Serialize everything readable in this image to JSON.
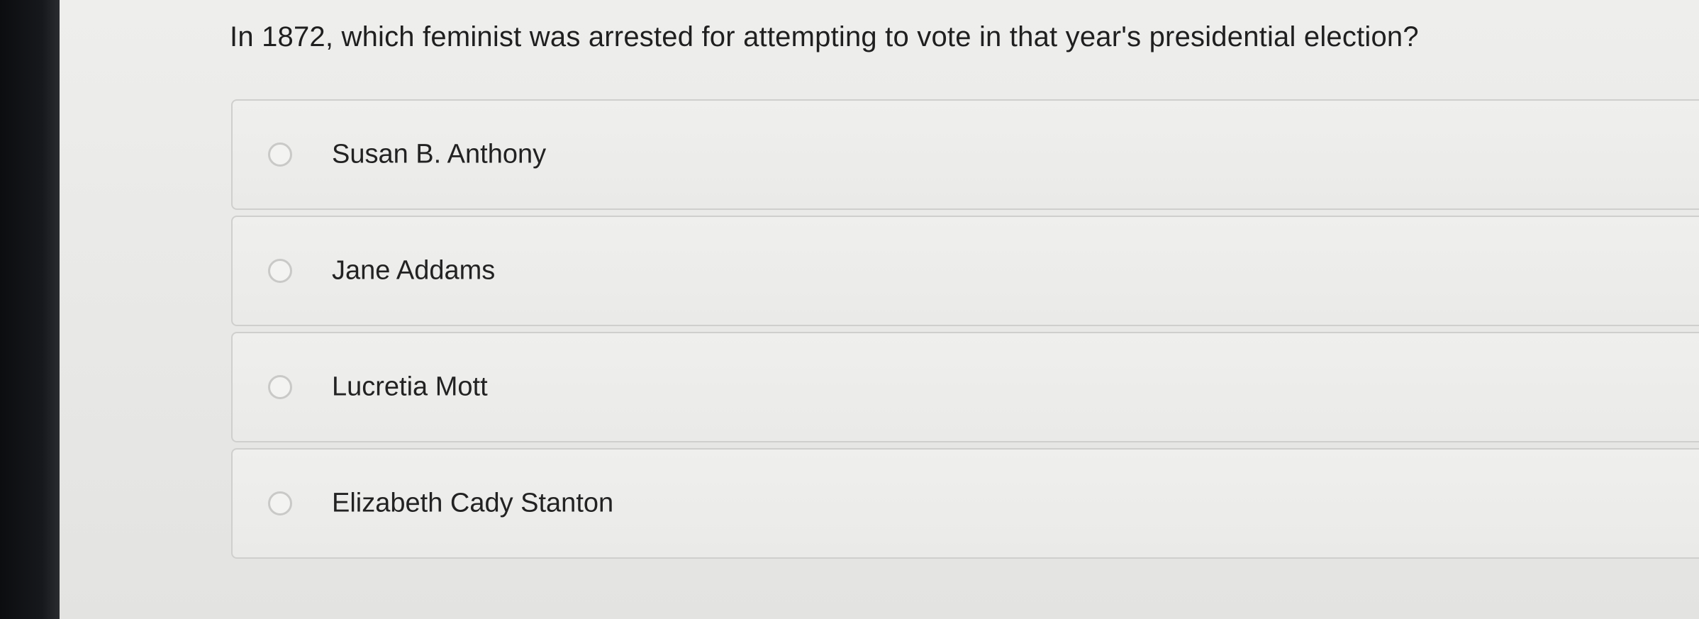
{
  "question": {
    "text": "In 1872, which feminist was arrested for attempting to vote in that year's presidential election?"
  },
  "options": [
    {
      "label": "Susan B. Anthony",
      "selected": false
    },
    {
      "label": "Jane Addams",
      "selected": false
    },
    {
      "label": "Lucretia Mott",
      "selected": false
    },
    {
      "label": "Elizabeth Cady Stanton",
      "selected": false
    }
  ],
  "colors": {
    "background": "#e9e9e7",
    "text": "#1f1f1f",
    "option_border": "#cfcfcd",
    "radio_border": "#c9c9c7"
  }
}
